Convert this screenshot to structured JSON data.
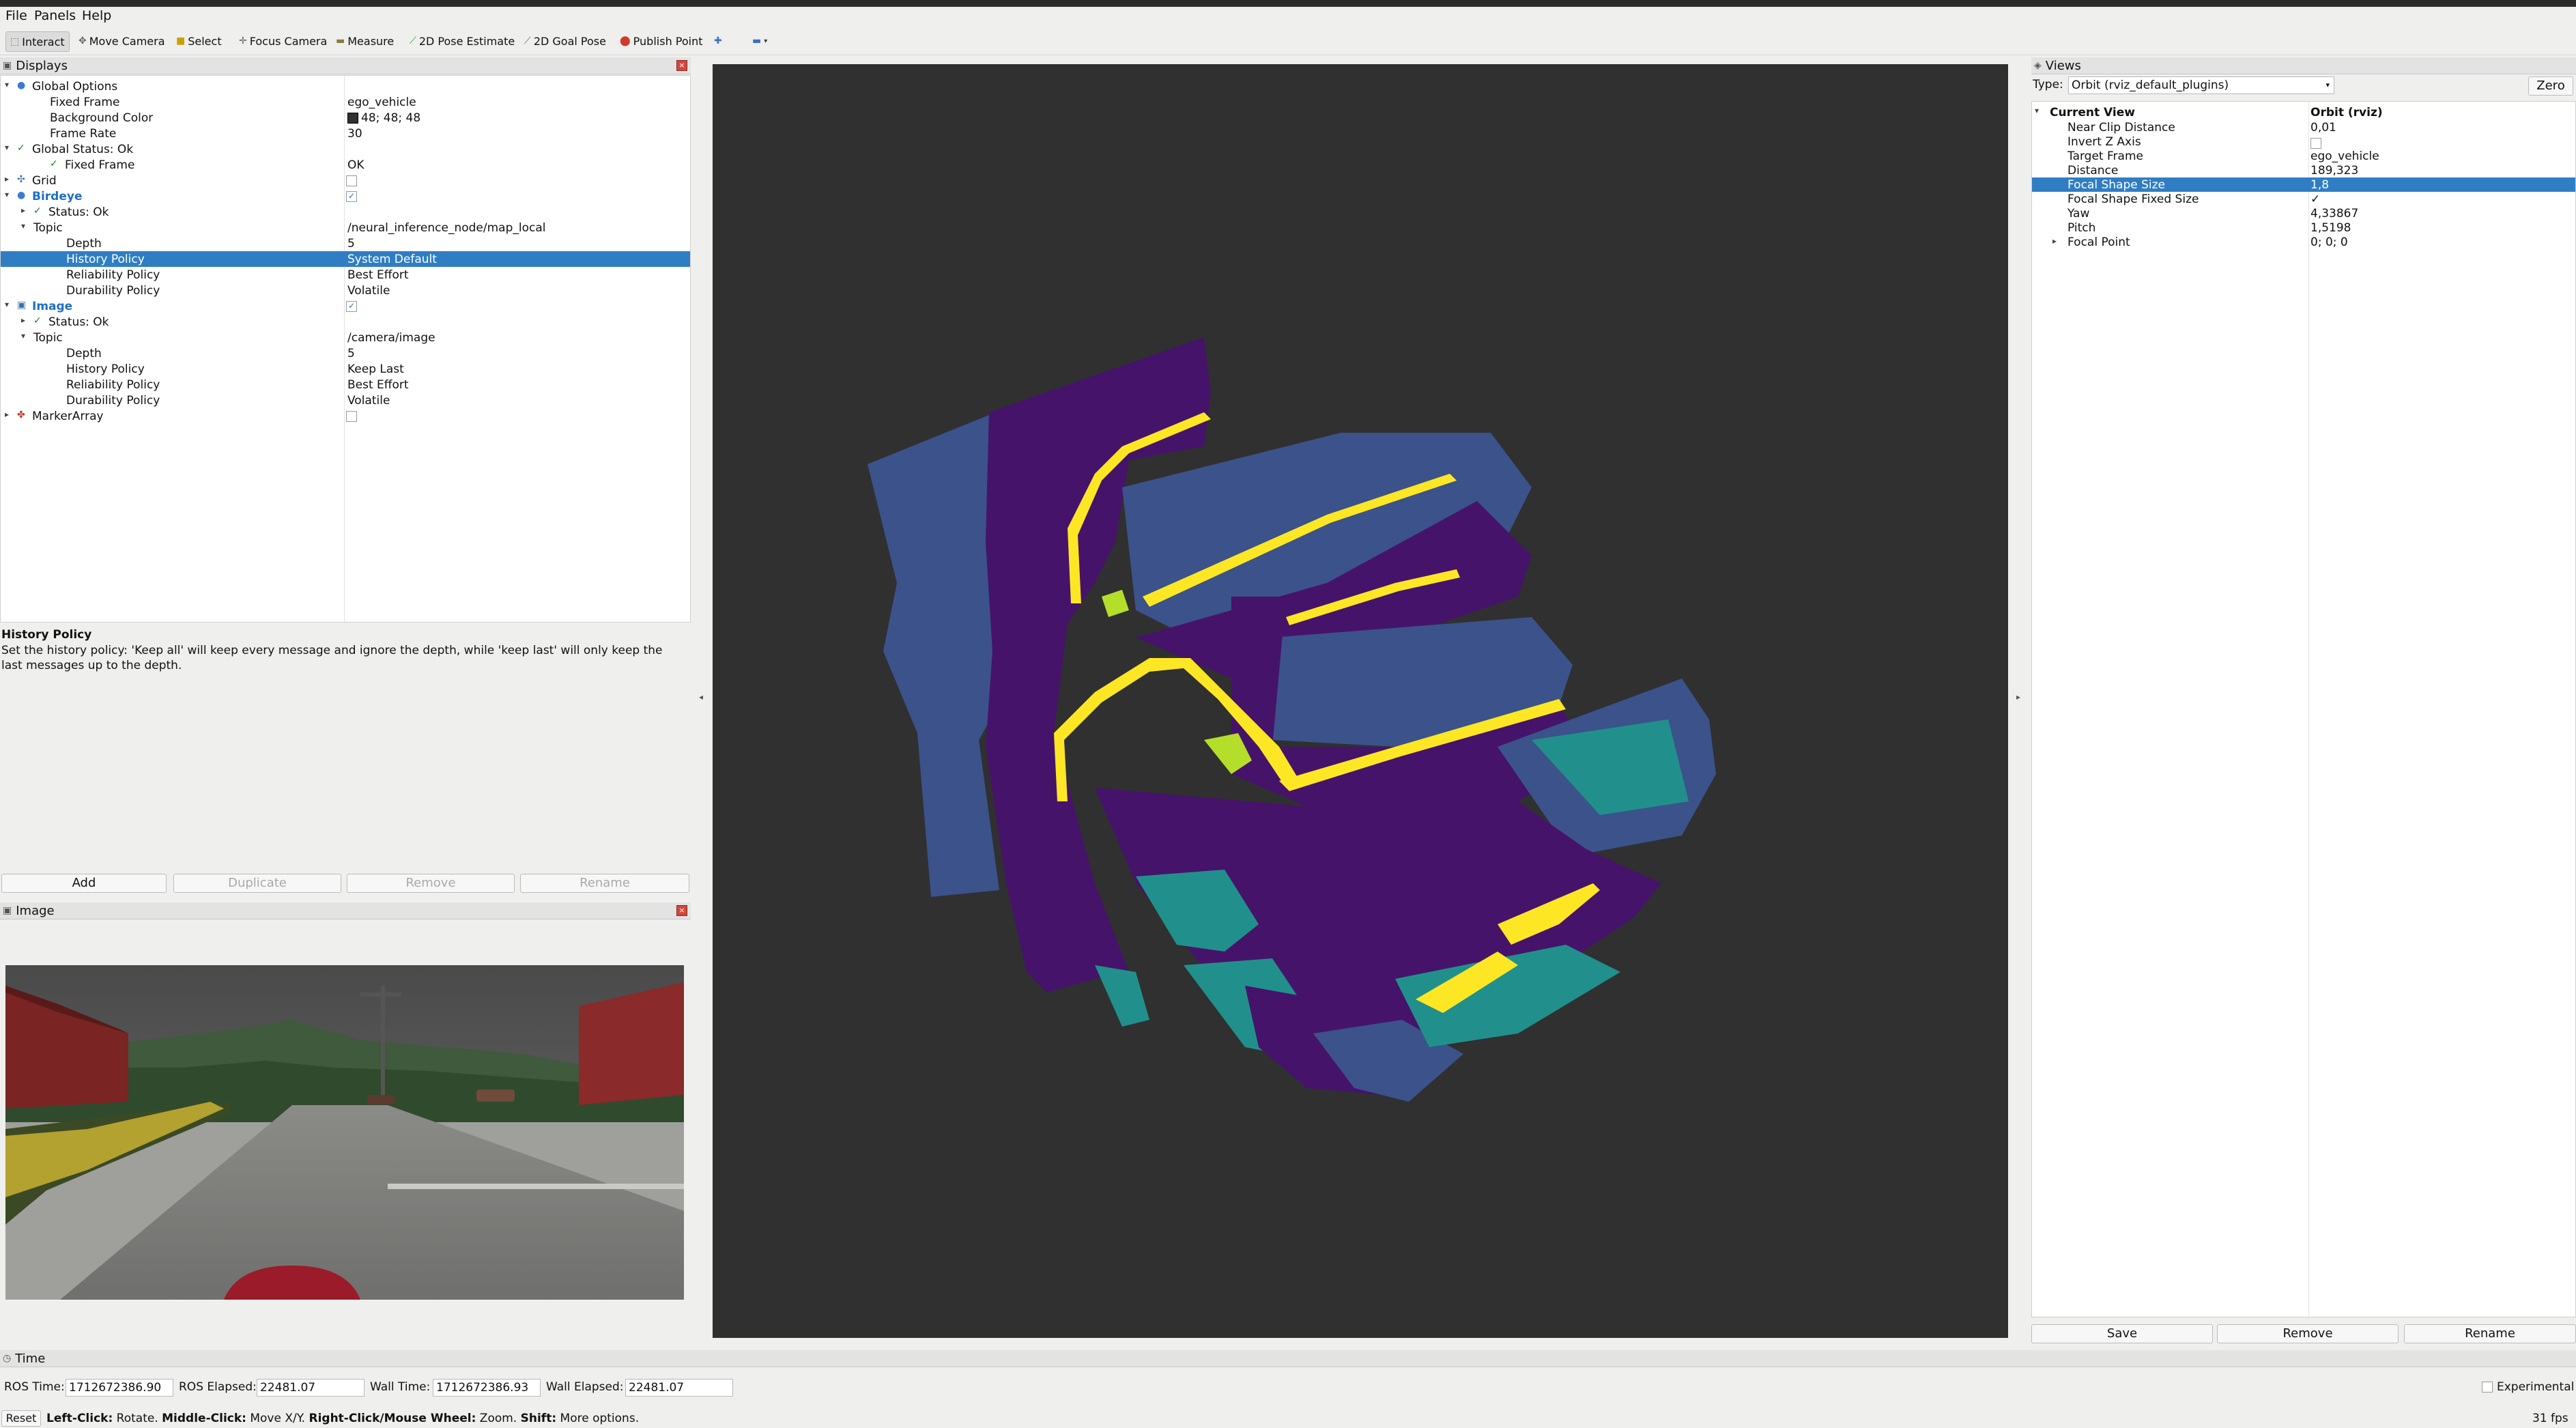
{
  "menu": {
    "file": "File",
    "panels": "Panels",
    "help": "Help"
  },
  "toolbar": {
    "interact": "Interact",
    "move_camera": "Move Camera",
    "select": "Select",
    "focus_camera": "Focus Camera",
    "measure": "Measure",
    "pose_estimate": "2D Pose Estimate",
    "goal_pose": "2D Goal Pose",
    "publish_point": "Publish Point"
  },
  "displays": {
    "title": "Displays",
    "rows": [
      {
        "name": "Global Options",
        "value": "",
        "indent": 0,
        "arrow": "▾",
        "icon": "dot",
        "style": ""
      },
      {
        "name": "Fixed Frame",
        "value": "ego_vehicle",
        "indent": 2,
        "arrow": "",
        "icon": "",
        "style": ""
      },
      {
        "name": "Background Color",
        "value": "48; 48; 48",
        "indent": 2,
        "arrow": "",
        "icon": "",
        "style": "",
        "swatch": "#303030"
      },
      {
        "name": "Frame Rate",
        "value": "30",
        "indent": 2,
        "arrow": "",
        "icon": "",
        "style": ""
      },
      {
        "name": "Global Status: Ok",
        "value": "",
        "indent": 0,
        "arrow": "▾",
        "icon": "check",
        "style": ""
      },
      {
        "name": "Fixed Frame",
        "value": "OK",
        "indent": 2,
        "arrow": "",
        "icon": "check",
        "style": ""
      },
      {
        "name": "Grid",
        "value": "",
        "indent": 0,
        "arrow": "▸",
        "icon": "grid",
        "style": "",
        "checkbox": false
      },
      {
        "name": "Birdeye",
        "value": "",
        "indent": 0,
        "arrow": "▾",
        "icon": "dot",
        "style": "blue",
        "checkbox": true
      },
      {
        "name": "Status: Ok",
        "value": "",
        "indent": 1,
        "arrow": "▸",
        "icon": "check",
        "style": ""
      },
      {
        "name": "Topic",
        "value": "/neural_inference_node/map_local",
        "indent": 1,
        "arrow": "▾",
        "icon": "",
        "style": ""
      },
      {
        "name": "Depth",
        "value": "5",
        "indent": 3,
        "arrow": "",
        "icon": "",
        "style": ""
      },
      {
        "name": "History Policy",
        "value": "System Default",
        "indent": 3,
        "arrow": "",
        "icon": "",
        "style": "",
        "selected": true
      },
      {
        "name": "Reliability Policy",
        "value": "Best Effort",
        "indent": 3,
        "arrow": "",
        "icon": "",
        "style": ""
      },
      {
        "name": "Durability Policy",
        "value": "Volatile",
        "indent": 3,
        "arrow": "",
        "icon": "",
        "style": ""
      },
      {
        "name": "Image",
        "value": "",
        "indent": 0,
        "arrow": "▾",
        "icon": "image",
        "style": "blue",
        "checkbox": true
      },
      {
        "name": "Status: Ok",
        "value": "",
        "indent": 1,
        "arrow": "▸",
        "icon": "check",
        "style": ""
      },
      {
        "name": "Topic",
        "value": "/camera/image",
        "indent": 1,
        "arrow": "▾",
        "icon": "",
        "style": ""
      },
      {
        "name": "Depth",
        "value": "5",
        "indent": 3,
        "arrow": "",
        "icon": "",
        "style": ""
      },
      {
        "name": "History Policy",
        "value": "Keep Last",
        "indent": 3,
        "arrow": "",
        "icon": "",
        "style": ""
      },
      {
        "name": "Reliability Policy",
        "value": "Best Effort",
        "indent": 3,
        "arrow": "",
        "icon": "",
        "style": ""
      },
      {
        "name": "Durability Policy",
        "value": "Volatile",
        "indent": 3,
        "arrow": "",
        "icon": "",
        "style": ""
      },
      {
        "name": "MarkerArray",
        "value": "",
        "indent": 0,
        "arrow": "▸",
        "icon": "marker",
        "style": "",
        "checkbox": false
      }
    ],
    "desc_title": "History Policy",
    "desc_text": "Set the history policy: 'Keep all' will keep every message and ignore the depth, while 'keep last' will only keep the last messages up to the depth.",
    "buttons": {
      "add": "Add",
      "duplicate": "Duplicate",
      "remove": "Remove",
      "rename": "Rename"
    }
  },
  "image_panel": {
    "title": "Image"
  },
  "views": {
    "title": "Views",
    "type_label": "Type:",
    "type_value": "Orbit (rviz_default_plugins)",
    "zero": "Zero",
    "header_name": "Current View",
    "header_value": "Orbit (rviz)",
    "rows": [
      {
        "name": "Near Clip Distance",
        "value": "0,01"
      },
      {
        "name": "Invert Z Axis",
        "value": "",
        "checkbox": false
      },
      {
        "name": "Target Frame",
        "value": "ego_vehicle"
      },
      {
        "name": "Distance",
        "value": "189,323"
      },
      {
        "name": "Focal Shape Size",
        "value": "1,8",
        "selected": true
      },
      {
        "name": "Focal Shape Fixed Size",
        "value": "✓"
      },
      {
        "name": "Yaw",
        "value": "4,33867"
      },
      {
        "name": "Pitch",
        "value": "1,5198"
      },
      {
        "name": "Focal Point",
        "value": "0; 0; 0",
        "arrow": "▸"
      }
    ],
    "buttons": {
      "save": "Save",
      "remove": "Remove",
      "rename": "Rename"
    }
  },
  "time": {
    "title": "Time",
    "ros_time_label": "ROS Time:",
    "ros_time": "1712672386.90",
    "ros_elapsed_label": "ROS Elapsed:",
    "ros_elapsed": "22481.07",
    "wall_time_label": "Wall Time:",
    "wall_time": "1712672386.93",
    "wall_elapsed_label": "Wall Elapsed:",
    "wall_elapsed": "22481.07",
    "experimental": "Experimental"
  },
  "status": {
    "reset": "Reset",
    "left_click": "Left-Click:",
    "left_click_desc": "Rotate.",
    "middle_click": "Middle-Click:",
    "middle_click_desc": "Move X/Y.",
    "right_click": "Right-Click/Mouse Wheel:",
    "right_click_desc": "Zoom.",
    "shift": "Shift:",
    "shift_desc": "More options.",
    "fps": "31 fps"
  },
  "colors": {
    "viewport_bg": "#303030",
    "selection": "#2f7ec4",
    "map_purple": "#46136b",
    "map_blue": "#3b528b",
    "map_teal": "#21908c",
    "map_yellow": "#fde725",
    "map_lime": "#b5de2b"
  }
}
